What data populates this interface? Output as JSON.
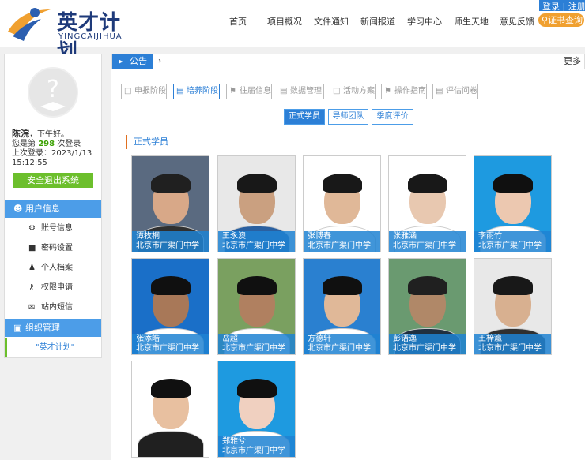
{
  "header": {
    "logo_cn": "英才计划",
    "logo_en": "YINGCAIJIHUA",
    "nav": [
      "首页",
      "项目概况",
      "文件通知",
      "新闻报道",
      "学习中心",
      "师生天地",
      "意见反馈"
    ],
    "login": "登录",
    "separator": "|",
    "register": "注册",
    "certificate": "证书查询"
  },
  "sidebar": {
    "user_name": "陈浣",
    "greeting": "，下午好。",
    "login_count_prefix": "您是第",
    "login_count": "298",
    "login_count_suffix": "次登录",
    "last_login_label": "上次登录：2023/1/13",
    "last_login_time": "15:12:55",
    "logout": "安全退出系统",
    "user_section": "用户信息",
    "user_items": [
      "账号信息",
      "密码设置",
      "个人档案",
      "权限申请",
      "站内短信"
    ],
    "org_section": "组织管理",
    "org_item": "\"英才计划\""
  },
  "notice": {
    "label": "公告",
    "arrow": "›",
    "more": "更多"
  },
  "stage_tabs": [
    "申报阶段",
    "培养阶段",
    "往届信息",
    "数据管理",
    "活动方案",
    "操作指南",
    "评估问卷"
  ],
  "stage_active": 1,
  "sub_tabs": [
    "正式学员",
    "导师团队",
    "季度评价"
  ],
  "section_title": "正式学员",
  "students": [
    {
      "name": "谭牧桐",
      "school": "北京市广渠门中学"
    },
    {
      "name": "王永澳",
      "school": "北京市广渠门中学"
    },
    {
      "name": "张博春",
      "school": "北京市广渠门中学"
    },
    {
      "name": "张雅涵",
      "school": "北京市广渠门中学"
    },
    {
      "name": "李雨竹",
      "school": "北京市广渠门中学"
    },
    {
      "name": "张添皓",
      "school": "北京市广渠门中学"
    },
    {
      "name": "岳超",
      "school": "北京市广渠门中学"
    },
    {
      "name": "方德轩",
      "school": "北京市广渠门中学"
    },
    {
      "name": "彭语逸",
      "school": "北京市广渠门中学"
    },
    {
      "name": "王梓瀛",
      "school": "北京市广渠门中学"
    },
    {
      "name": "",
      "school": ""
    },
    {
      "name": "郑雅兮",
      "school": "北京市广渠门中学"
    }
  ],
  "colors": {
    "primary": "#2c7fd6",
    "accent": "#f0a030",
    "green": "#6cbf2c"
  }
}
